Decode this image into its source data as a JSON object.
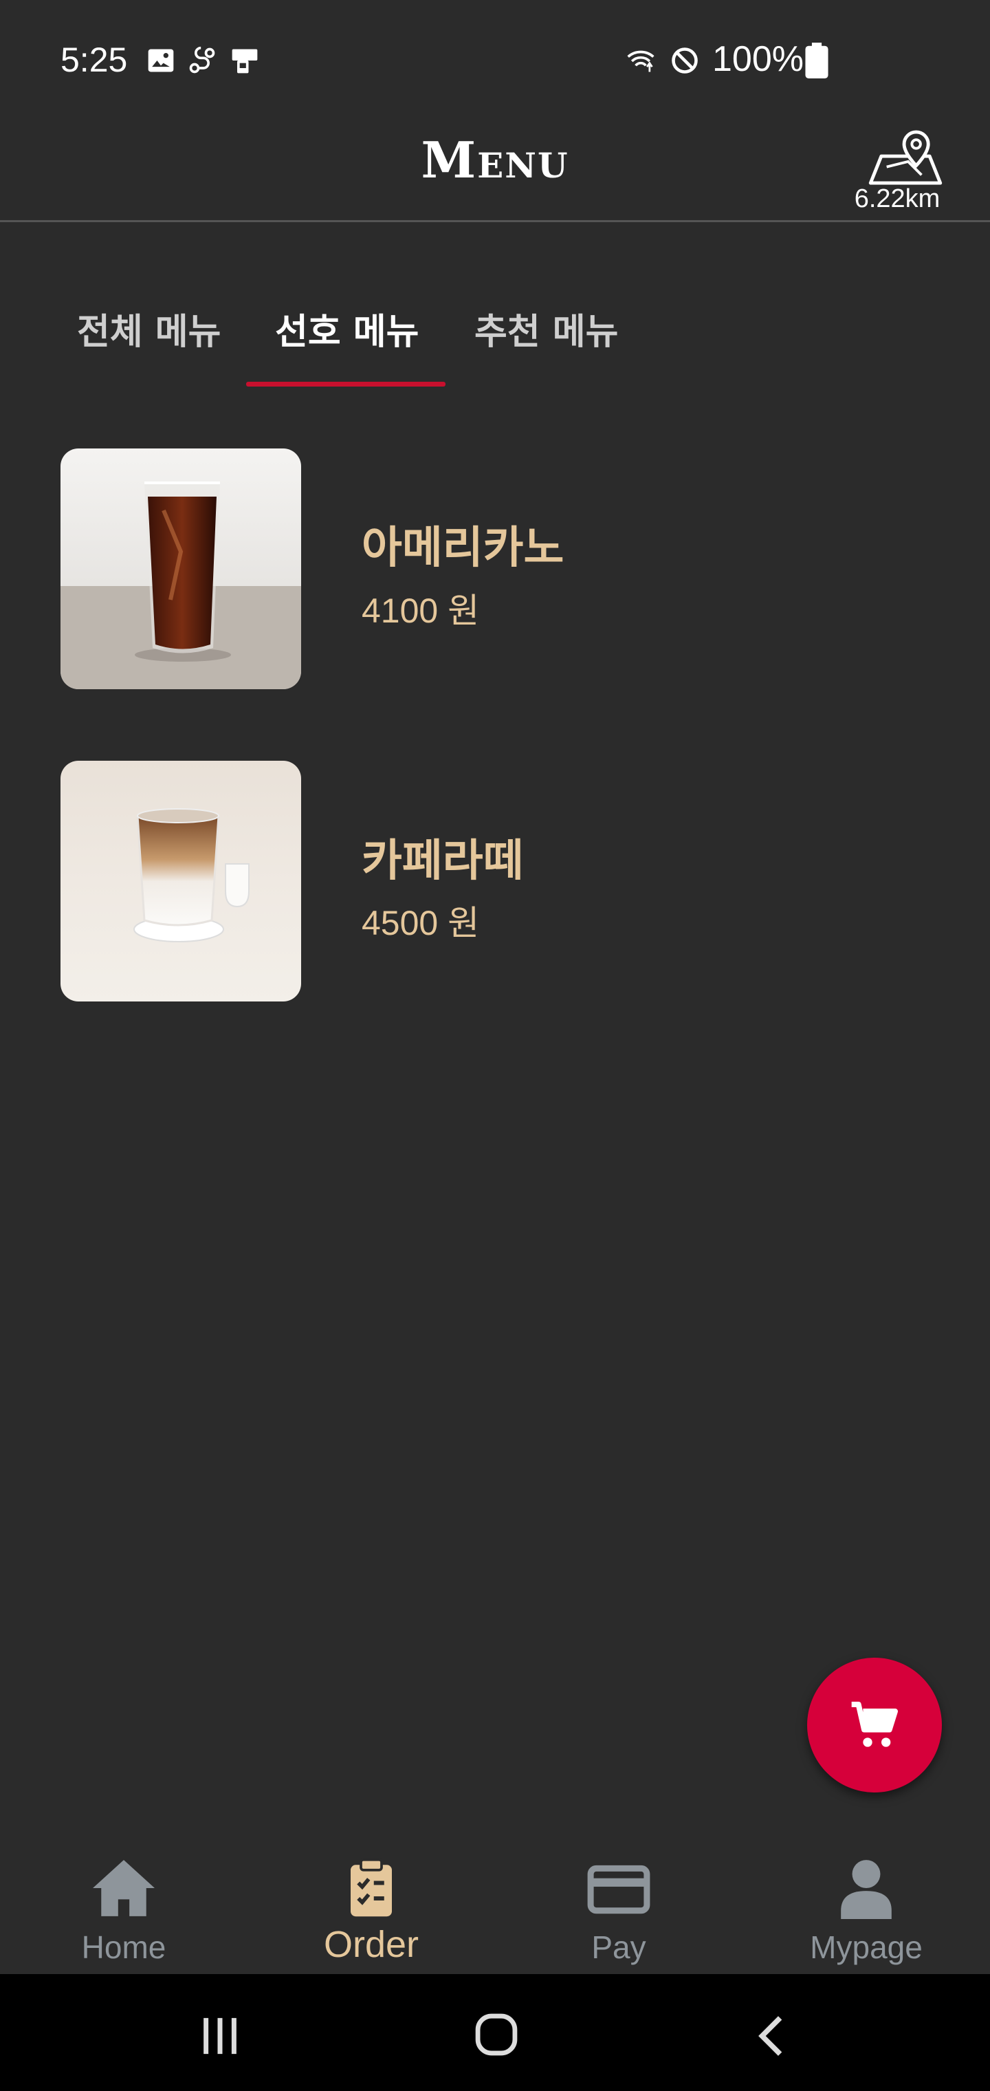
{
  "status_bar": {
    "time": "5:25",
    "battery": "100%",
    "icons": [
      "gallery-icon",
      "route-icon",
      "device-icon",
      "wifi-icon",
      "do-not-disturb-icon",
      "battery-icon"
    ]
  },
  "header": {
    "title": "Menu",
    "distance": "6.22km",
    "location_icon": "map-pin-icon"
  },
  "tabs": [
    {
      "label": "전체 메뉴",
      "active": false
    },
    {
      "label": "선호 메뉴",
      "active": true
    },
    {
      "label": "추천 메뉴",
      "active": false
    }
  ],
  "items": [
    {
      "name": "아메리카노",
      "price": "4100 원",
      "image": "iced-americano-photo"
    },
    {
      "name": "카페라떼",
      "price": "4500 원",
      "image": "iced-cafe-latte-photo"
    }
  ],
  "fab": {
    "icon": "cart-icon"
  },
  "bottom_nav": [
    {
      "label": "Home",
      "icon": "home-icon",
      "active": false
    },
    {
      "label": "Order",
      "icon": "clipboard-check-icon",
      "active": true
    },
    {
      "label": "Pay",
      "icon": "card-icon",
      "active": false
    },
    {
      "label": "Mypage",
      "icon": "user-icon",
      "active": false
    }
  ],
  "colors": {
    "background": "#2b2b2b",
    "accent": "#c8102e",
    "gold": "#e5c79b",
    "inactive": "#8e959b"
  }
}
